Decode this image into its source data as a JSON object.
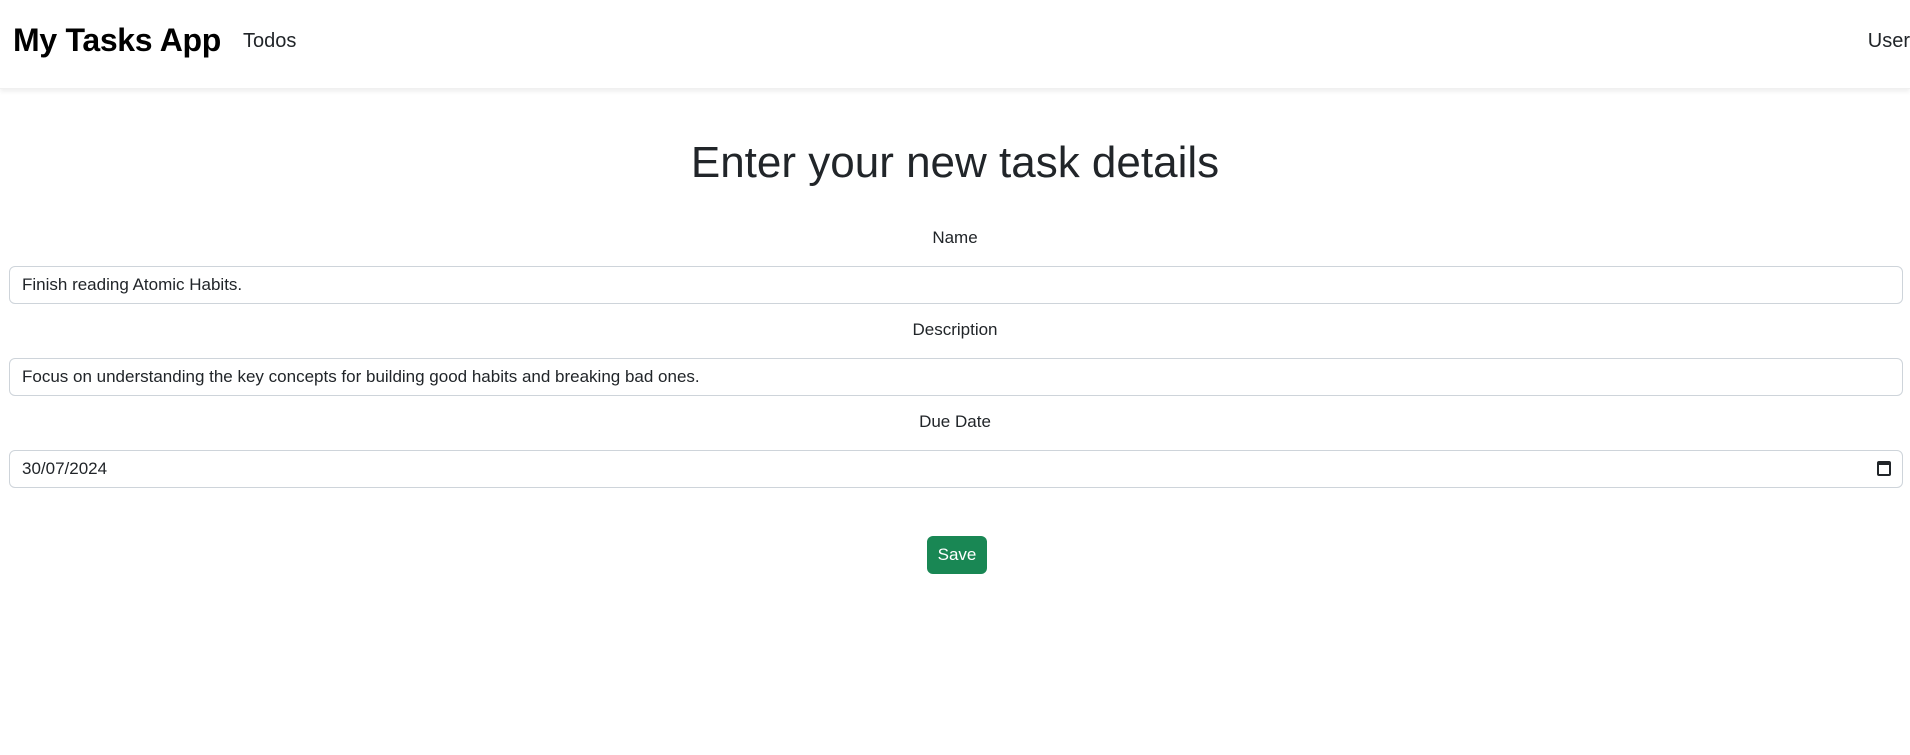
{
  "navbar": {
    "brand": "My Tasks App",
    "links": [
      {
        "label": "Todos"
      }
    ],
    "user_label": "User"
  },
  "page": {
    "title": "Enter your new task details"
  },
  "form": {
    "name": {
      "label": "Name",
      "value": "Finish reading Atomic Habits."
    },
    "description": {
      "label": "Description",
      "value": "Focus on understanding the key concepts for building good habits and breaking bad ones."
    },
    "due_date": {
      "label": "Due Date",
      "value": "30/07/2024",
      "icon": "calendar-icon"
    },
    "save_label": "Save"
  },
  "colors": {
    "save_button_bg": "#198754",
    "text": "#212529",
    "input_border": "#ced4da"
  }
}
